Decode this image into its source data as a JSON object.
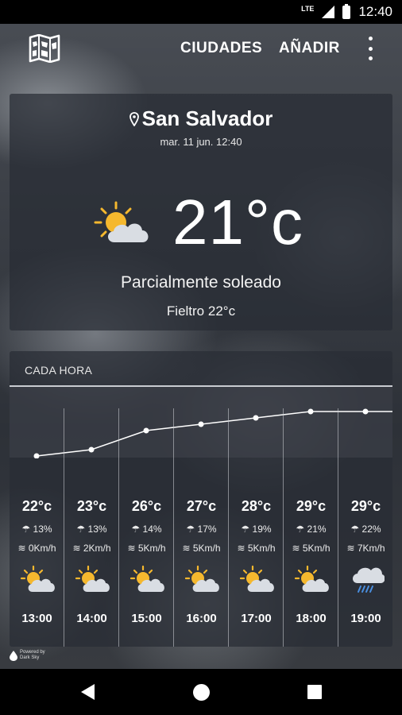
{
  "status_bar": {
    "network": "LTE",
    "time": "12:40"
  },
  "app_bar": {
    "map_icon": "folded-map-icon",
    "cities_label": "CIUDADES",
    "add_label": "AÑADIR",
    "menu_icon": "kebab-menu-icon"
  },
  "current": {
    "city": "San Salvador",
    "datetime": "mar. 11 jun. 12:40",
    "icon": "partly-sunny-icon",
    "temperature": "21°c",
    "summary": "Parcialmente soleado",
    "feels_like": "Fieltro 22°c"
  },
  "hourly": {
    "title": "CADA HORA",
    "hours": [
      {
        "time": "13:00",
        "temp": "22°c",
        "rain": "13%",
        "wind": "0Km/h",
        "icon": "partly-sunny-icon",
        "temp_value": 22
      },
      {
        "time": "14:00",
        "temp": "23°c",
        "rain": "13%",
        "wind": "2Km/h",
        "icon": "partly-sunny-icon",
        "temp_value": 23
      },
      {
        "time": "15:00",
        "temp": "26°c",
        "rain": "14%",
        "wind": "5Km/h",
        "icon": "partly-sunny-icon",
        "temp_value": 26
      },
      {
        "time": "16:00",
        "temp": "27°c",
        "rain": "17%",
        "wind": "5Km/h",
        "icon": "partly-sunny-icon",
        "temp_value": 27
      },
      {
        "time": "17:00",
        "temp": "28°c",
        "rain": "19%",
        "wind": "5Km/h",
        "icon": "partly-sunny-icon",
        "temp_value": 28
      },
      {
        "time": "18:00",
        "temp": "29°c",
        "rain": "21%",
        "wind": "5Km/h",
        "icon": "partly-sunny-icon",
        "temp_value": 29
      },
      {
        "time": "19:00",
        "temp": "29°c",
        "rain": "22%",
        "wind": "7Km/h",
        "icon": "rain-cloud-icon",
        "temp_value": 29
      }
    ]
  },
  "powered_by": {
    "line1": "Powered by",
    "line2": "Dark Sky"
  },
  "nav_bar": {
    "back_icon": "back-triangle-icon",
    "home_icon": "home-circle-icon",
    "recents_icon": "recents-square-icon"
  }
}
